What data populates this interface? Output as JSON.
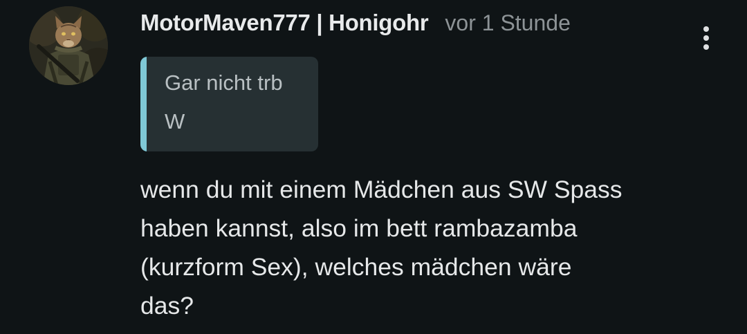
{
  "comment": {
    "author": "MotorMaven777 | Honigohr",
    "timestamp": "vor 1 Stunde",
    "quote": {
      "author": "Gar nicht trb",
      "text": "W"
    },
    "body_lines": [
      "wenn du mit einem Mädchen aus SW Spass",
      "haben kannst, also im bett rambazamba",
      "(kurzform Sex), welches mädchen wäre",
      "das?"
    ]
  },
  "icons": {
    "menu": "more-vertical-icon",
    "avatar": "cat-soldier-avatar"
  },
  "colors": {
    "background": "#0f1416",
    "quote_background": "#263033",
    "quote_accent": "#7fc8d6",
    "timestamp": "#8d9396"
  }
}
